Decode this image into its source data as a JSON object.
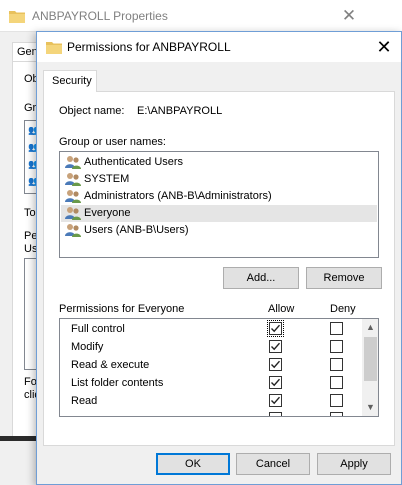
{
  "background_window": {
    "title": "ANBPAYROLL Properties",
    "close_glyph": "✕",
    "tab_fragment": "Gen",
    "text_fragments": [
      "Obj",
      "Gro",
      "To",
      "Pern",
      "Us",
      "For",
      "clic"
    ]
  },
  "dialog": {
    "title": "Permissions for ANBPAYROLL",
    "close_glyph": "✕",
    "tab_label": "Security",
    "object_name_label": "Object name:",
    "object_name_value": "E:\\ANBPAYROLL",
    "group_label": "Group or user names:",
    "principals": [
      {
        "name": "Authenticated Users",
        "icon": "users-icon",
        "selected": false
      },
      {
        "name": "SYSTEM",
        "icon": "users-icon",
        "selected": false
      },
      {
        "name": "Administrators (ANB-B\\Administrators)",
        "icon": "users-icon",
        "selected": false
      },
      {
        "name": "Everyone",
        "icon": "users-icon",
        "selected": true
      },
      {
        "name": "Users (ANB-B\\Users)",
        "icon": "users-icon",
        "selected": false
      }
    ],
    "add_button": "Add...",
    "remove_button": "Remove",
    "permissions_label": "Permissions for Everyone",
    "allow_header": "Allow",
    "deny_header": "Deny",
    "permissions": [
      {
        "name": "Full control",
        "allow": true,
        "deny": false
      },
      {
        "name": "Modify",
        "allow": true,
        "deny": false
      },
      {
        "name": "Read & execute",
        "allow": true,
        "deny": false
      },
      {
        "name": "List folder contents",
        "allow": true,
        "deny": false
      },
      {
        "name": "Read",
        "allow": true,
        "deny": false
      },
      {
        "name": "",
        "allow": false,
        "deny": false
      }
    ],
    "ok_button": "OK",
    "cancel_button": "Cancel",
    "apply_button": "Apply"
  },
  "colors": {
    "accent": "#0078d7",
    "folder": "#e8c15c",
    "selection": "#e5e5e5"
  }
}
